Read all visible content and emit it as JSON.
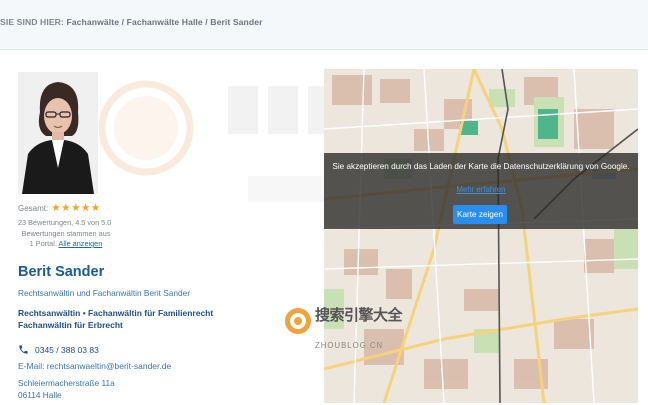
{
  "breadcrumb": {
    "prefix": "SIE SIND HIER:",
    "path": "Fachanwälte / Fachanwälte Halle / Berit Sander"
  },
  "profile": {
    "rating_label": "Gesamt:",
    "stars": 5,
    "review_count": "23 Bewertungen, 4.5 von 5.0",
    "review_source_line1": "Bewertungen stammen aus",
    "review_source_line2": "1 Portal.",
    "show_all_link": "Alle anzeigen",
    "name": "Berit Sander",
    "subtitle": "Rechtsanwältin und Fachanwältin Berit Sander",
    "specialty_1": "Rechtsanwältin • Fachanwältin für Familienrecht",
    "specialty_2": "Fachanwältin für Erbrecht",
    "phone": "0345 / 388 03 83",
    "email": "E-Mail: rechtsanwaeltin@berit-sander.de",
    "street": "Schleiermacherstraße 11a",
    "city": "06114 Halle"
  },
  "map": {
    "consent_text": "Sie akzeptieren durch das Laden der Karte die Datenschutzerklärung von Google.",
    "more_link": "Mehr erfahren",
    "show_button": "Karte zeigen"
  },
  "watermark": {
    "title": "搜索引擎大全",
    "subtitle": "ZHOUBLOG.CN"
  },
  "colors": {
    "accent_blue": "#1b5aa0",
    "star_color": "#f5a623",
    "button_blue": "#2a8ef0",
    "overlay": "#282828"
  }
}
